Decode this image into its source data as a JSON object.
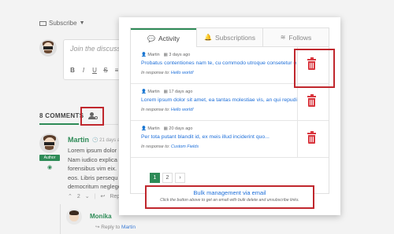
{
  "page": {
    "subscribe_label": "Subscribe",
    "editor_placeholder": "Join the discussi",
    "editor_toolbar": [
      "B",
      "I",
      "U",
      "S",
      "≡"
    ],
    "comments_count": "8 COMMENTS",
    "comment1": {
      "author": "Martin",
      "time": "21 days ag",
      "badge": "Author",
      "lines": [
        "Lorem ipsum dolor",
        "Nam iudico explica",
        "forensibus vim eix.",
        "eos. Libris persequ",
        "democritum neglege"
      ],
      "votes": "2",
      "reply_label": "Reply"
    },
    "comment2": {
      "author": "Monika",
      "reply_to_label": "Reply to",
      "reply_to_name": "Martin"
    }
  },
  "popup": {
    "tabs": [
      {
        "label": "Activity",
        "icon": "comments-icon",
        "active": true
      },
      {
        "label": "Subscriptions",
        "icon": "bell-icon",
        "active": false
      },
      {
        "label": "Follows",
        "icon": "rss-icon",
        "active": false
      }
    ],
    "rows": [
      {
        "user": "Martin",
        "date": "3 days ago",
        "title": "Probatus contentiones nam te, cu commodo utroque consetetur e...",
        "response_label": "In response to:",
        "response_link": "Hello world!"
      },
      {
        "user": "Martin",
        "date": "17 days ago",
        "title": "Lorem ipsum dolor sit amet, ea tantas molestiae vis, an qui repudia...",
        "response_label": "In response to:",
        "response_link": "Hello world!"
      },
      {
        "user": "Martin",
        "date": "20 days ago",
        "title": "Per tota putant blandit id, ex meis illud inciderint quo...",
        "response_label": "In response to:",
        "response_link": "Custom Fields"
      }
    ],
    "pagination": [
      "1",
      "2",
      "›"
    ],
    "bulk": {
      "title": "Bulk management via email",
      "subtitle": "Click the button above to get an email with bulk delete and unsubscribe links."
    }
  },
  "colors": {
    "accent_green": "#2e8b57",
    "link_blue": "#1e6fd9",
    "trash_red": "#d9363e",
    "highlight_red": "#c0272d"
  }
}
